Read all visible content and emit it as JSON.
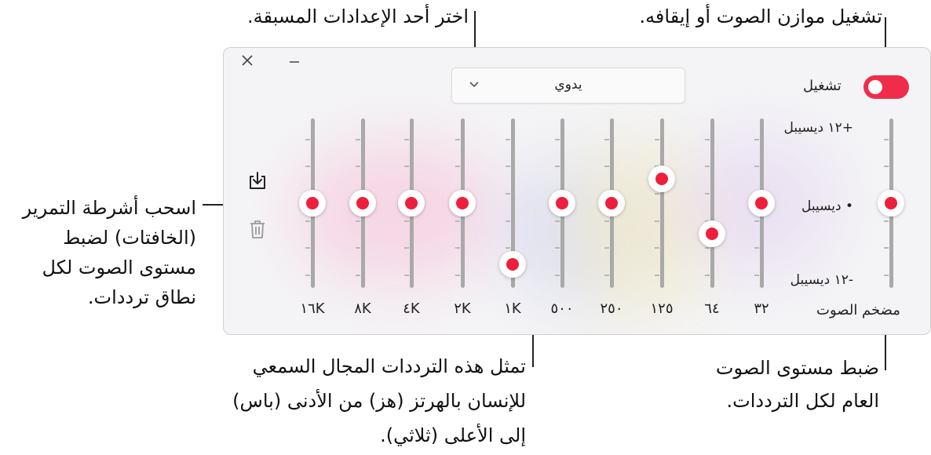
{
  "callouts": {
    "presets": "اختر أحد الإعدادات المسبقة.",
    "toggle": "تشغيل موازن الصوت أو إيقافه.",
    "sliders": [
      "اسحب أشرطة التمرير",
      "(الخافتات) لضبط",
      "مستوى الصوت لكل",
      "نطاق ترددات."
    ],
    "frequencies": [
      "تمثل هذه الترددات المجال السمعي",
      "للإنسان بالهرتز (هز) من الأدنى (باس)",
      "إلى الأعلى (ثلاثي)."
    ],
    "volume": [
      "ضبط مستوى الصوت",
      "العام لكل الترددات."
    ]
  },
  "window": {
    "close_icon": "close-icon",
    "minimize_icon": "minimize-icon",
    "preset": {
      "selected": "يدوي",
      "icon": "chevron-down-icon"
    },
    "toggle": {
      "label": "تشغيل",
      "on": true,
      "color": "#ef2d4a"
    },
    "db_labels": {
      "top": "+١٢ ديسيبل",
      "middle": "• ديسيبل",
      "bottom": "-١٢ ديسيبل"
    },
    "volume_label": "مضخم الصوت",
    "save_icon": "save-preset-icon",
    "delete_icon": "trash-icon",
    "preamp_db": 0,
    "bands": [
      {
        "label": "٣٢",
        "db": 0
      },
      {
        "label": "٦٤",
        "db": -5
      },
      {
        "label": "١٢٥",
        "db": 4
      },
      {
        "label": "٢٥٠",
        "db": 0
      },
      {
        "label": "٥٠٠",
        "db": 0
      },
      {
        "label": "١K",
        "db": -10
      },
      {
        "label": "٢K",
        "db": 0
      },
      {
        "label": "٤K",
        "db": 0
      },
      {
        "label": "٨K",
        "db": 0
      },
      {
        "label": "١٦K",
        "db": 0
      }
    ]
  }
}
